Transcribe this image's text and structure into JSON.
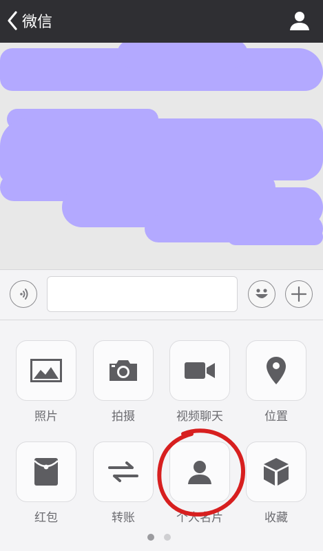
{
  "navbar": {
    "back_label": "微信"
  },
  "input_bar": {
    "value": "",
    "placeholder": ""
  },
  "panel": {
    "row1": [
      {
        "label": "照片",
        "icon": "image-icon"
      },
      {
        "label": "拍摄",
        "icon": "camera-icon"
      },
      {
        "label": "视频聊天",
        "icon": "video-camera-icon"
      },
      {
        "label": "位置",
        "icon": "location-pin-icon"
      }
    ],
    "row2": [
      {
        "label": "红包",
        "icon": "red-packet-icon"
      },
      {
        "label": "转账",
        "icon": "transfer-arrows-icon"
      },
      {
        "label": "个人名片",
        "icon": "contact-card-icon"
      },
      {
        "label": "收藏",
        "icon": "favorites-cube-icon"
      }
    ]
  },
  "pager": {
    "total": 2,
    "active": 1
  },
  "colors": {
    "navbar": "#2f2f33",
    "icon_gray": "#5d5d61",
    "redaction": "#b3a9ff",
    "annotation_circle": "#d71f1f"
  }
}
